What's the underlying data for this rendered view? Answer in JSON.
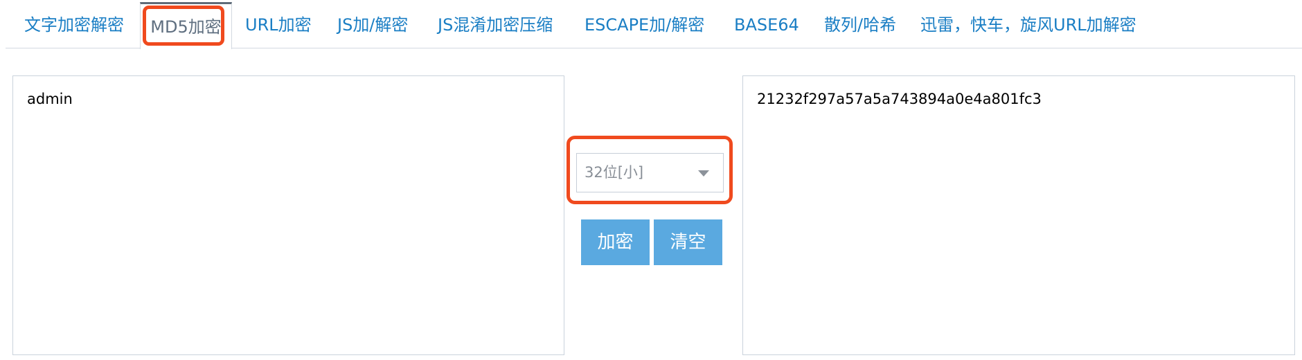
{
  "tabs": [
    {
      "label": "文字加密解密"
    },
    {
      "label": "MD5加密",
      "active": true
    },
    {
      "label": "URL加密"
    },
    {
      "label": "JS加/解密"
    },
    {
      "label": "JS混淆加密压缩"
    },
    {
      "label": "ESCAPE加/解密"
    },
    {
      "label": "BASE64"
    },
    {
      "label": "散列/哈希"
    },
    {
      "label": "迅雷，快车，旋风URL加解密"
    }
  ],
  "input": {
    "value": "admin"
  },
  "mode_select": {
    "selected": "32位[小]",
    "icon": "chevron-down-icon"
  },
  "buttons": {
    "encrypt_label": "加密",
    "clear_label": "清空"
  },
  "output": {
    "value": "21232f297a57a5a743894a0e4a801fc3"
  },
  "colors": {
    "link": "#1a7ec4",
    "active_tab_text": "#5f6f80",
    "button_bg": "#5aa9e0",
    "highlight_outline": "#f04a1e",
    "border": "#c9d2dc"
  }
}
